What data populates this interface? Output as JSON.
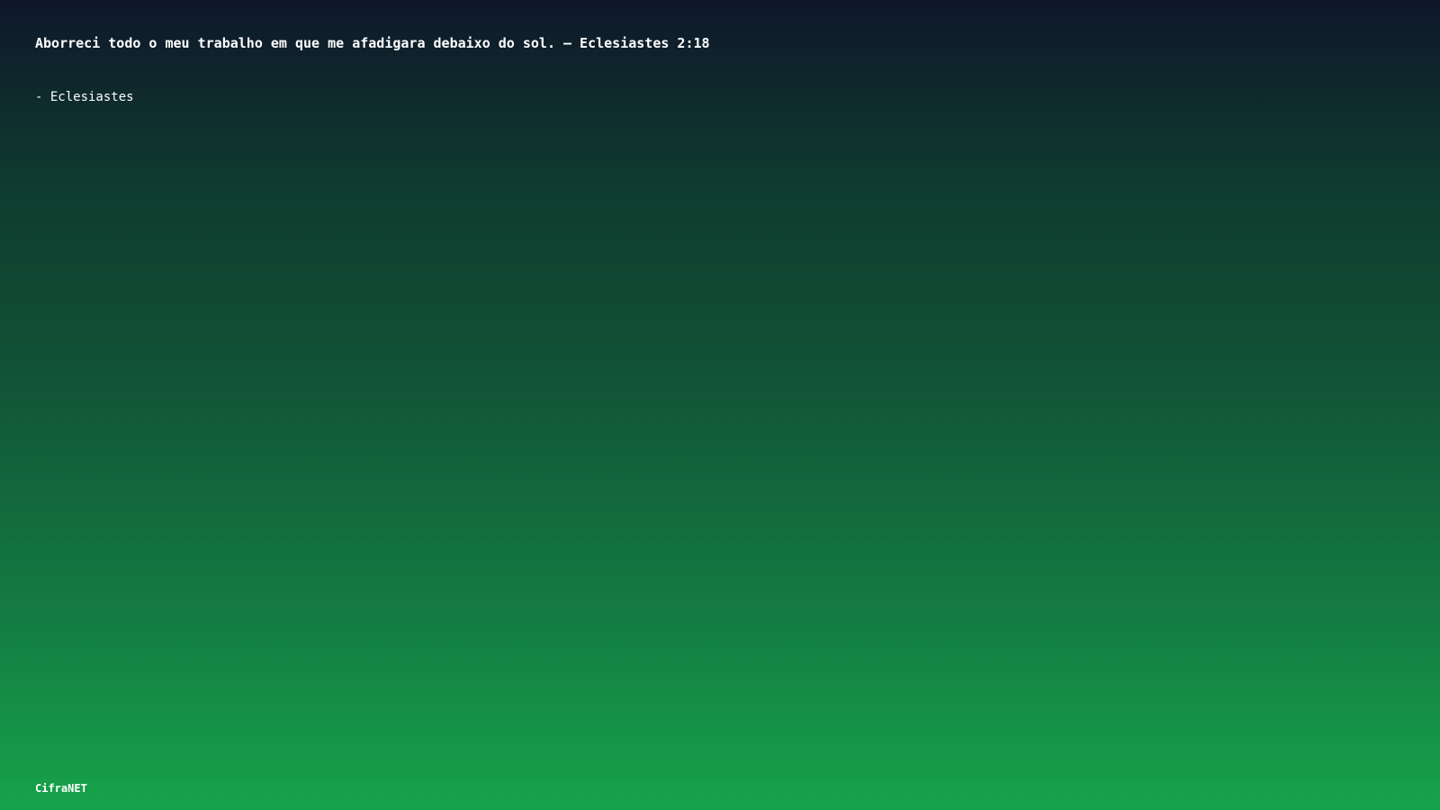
{
  "quote": {
    "text": "Aborreci todo o meu trabalho em que me afadigara debaixo do sol. — Eclesiastes 2:18",
    "author": "- Eclesiastes"
  },
  "footer": {
    "brand": "CifraNET"
  },
  "colors": {
    "gradient_top": "#0f172a",
    "gradient_bottom": "#16a34a",
    "text": "#ffffff"
  }
}
